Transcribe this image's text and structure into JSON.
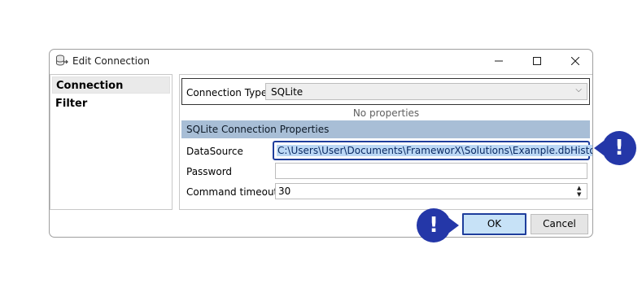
{
  "window": {
    "title": "Edit Connection",
    "app_icon": "database-connection-icon",
    "controls": {
      "minimize": "minimize-icon",
      "maximize": "maximize-icon",
      "close": "close-icon"
    }
  },
  "sidebar": {
    "items": [
      {
        "label": "Connection",
        "selected": true
      },
      {
        "label": "Filter",
        "selected": false
      }
    ]
  },
  "connection_type": {
    "label": "Connection Type",
    "selected_value": "SQLite",
    "chevron": "chevron-down-icon"
  },
  "no_properties_text": "No properties",
  "section": {
    "title": "SQLite Connection Properties",
    "fields": [
      {
        "label": "DataSource",
        "value": "C:\\Users\\User\\Documents\\FrameworX\\Solutions\\Example.dbHistorian"
      },
      {
        "label": "Password",
        "value": ""
      },
      {
        "label": "Command timeout",
        "value": "30"
      }
    ]
  },
  "buttons": {
    "ok": "OK",
    "cancel": "Cancel"
  },
  "callouts": {
    "symbol": "!"
  },
  "colors": {
    "accent": "#1f3e9c",
    "callout": "#2437a8",
    "section_header_bg": "#a8bed6",
    "ok_button_bg": "#c7e2f7"
  }
}
